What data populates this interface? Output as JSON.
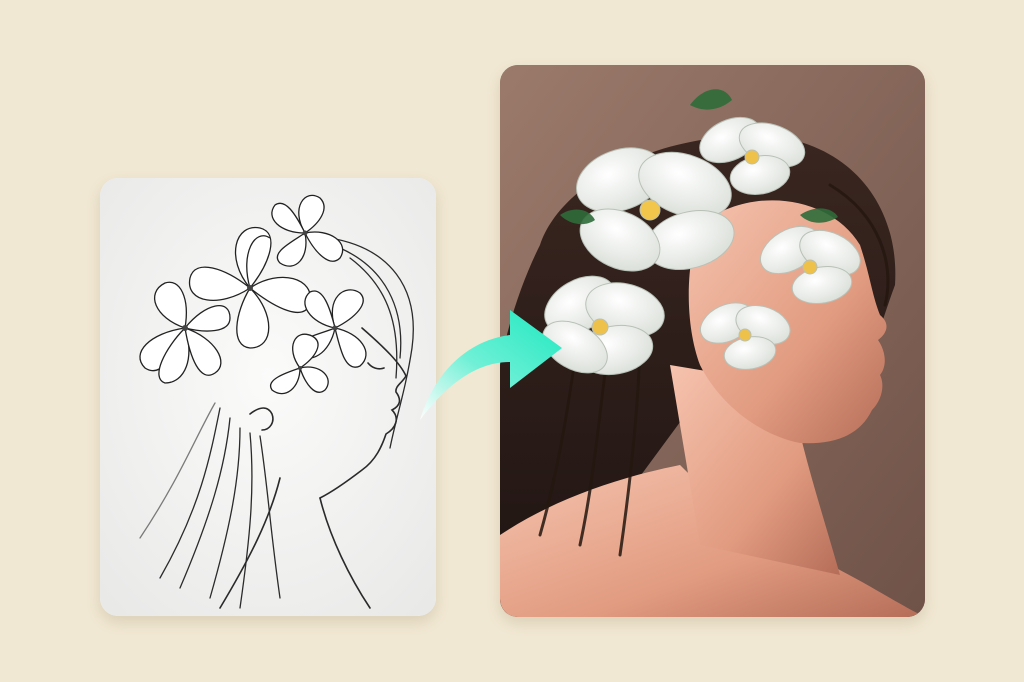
{
  "colors": {
    "background": "#f1e8d3",
    "arrow_start": "#ffffff",
    "arrow_end": "#1ee8c0",
    "sketch_paper": "#f4f4f3",
    "painting_bg": "#8c6a5d"
  },
  "images": {
    "sketch": {
      "kind": "pencil-sketch",
      "subject": "woman-profile-with-flower-crown"
    },
    "painting": {
      "kind": "digital-painting",
      "subject": "woman-profile-with-white-flower-crown"
    }
  },
  "icons": {
    "transform": "curved-arrow-icon"
  }
}
